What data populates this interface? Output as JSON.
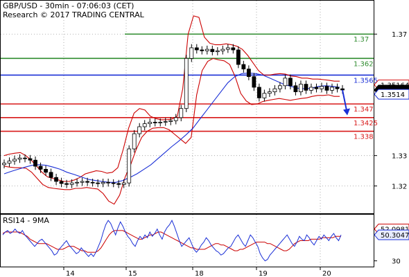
{
  "header": {
    "title": "GBP/USD - 30min - 07:06:03 (CET)",
    "subtitle": "Research © 2017 TRADING CENTRAL"
  },
  "rsi_label": "RSI14 - 9MA",
  "colors": {
    "resistance": "#2e8b2e",
    "pivot": "#1a2fd6",
    "support": "#d81818",
    "bollinger": "#cc0000",
    "ma": "#1a2fd6",
    "candle": "#000000",
    "rsi": "#1a2fd6",
    "rsi_ma": "#cc0000",
    "arrow": "#1a2fd6"
  },
  "chart_data": [
    {
      "type": "line",
      "title": "GBP/USD - 30min",
      "x_ticks": [
        "14",
        "15",
        "18",
        "19",
        "20"
      ],
      "ylim": [
        1.311,
        1.381
      ],
      "y_ticks": [
        1.32,
        1.33,
        1.37
      ],
      "grid": true,
      "levels": [
        {
          "label": "1.37",
          "value": 1.37,
          "kind": "resistance"
        },
        {
          "label": "1.362",
          "value": 1.362,
          "kind": "resistance"
        },
        {
          "label": "1.3565",
          "value": 1.3565,
          "kind": "pivot"
        },
        {
          "label": "1.347",
          "value": 1.347,
          "kind": "support"
        },
        {
          "label": "1.3425",
          "value": 1.3425,
          "kind": "support"
        },
        {
          "label": "1.338",
          "value": 1.338,
          "kind": "support"
        }
      ],
      "price_labels": [
        {
          "label": "1.35164",
          "value": 1.3533,
          "style": "support-box"
        },
        {
          "label": "1.3516",
          "value": 1.3516,
          "style": "black-box"
        },
        {
          "label": "1.3514",
          "value": 1.3502,
          "style": "blue-box"
        }
      ],
      "series": [
        {
          "type": "candles",
          "close": [
            1.3275,
            1.3282,
            1.3288,
            1.3292,
            1.329,
            1.3285,
            1.3265,
            1.3255,
            1.3245,
            1.3228,
            1.3215,
            1.3208,
            1.3205,
            1.321,
            1.3212,
            1.3215,
            1.3212,
            1.321,
            1.3208,
            1.3212,
            1.321,
            1.3208,
            1.3205,
            1.321,
            1.3322,
            1.3372,
            1.3395,
            1.3405,
            1.341,
            1.3408,
            1.341,
            1.3412,
            1.3415,
            1.3425,
            1.3455,
            1.362,
            1.3655,
            1.3648,
            1.3645,
            1.365,
            1.3642,
            1.3645,
            1.365,
            1.3655,
            1.3648,
            1.36,
            1.3585,
            1.356,
            1.3525,
            1.349,
            1.3505,
            1.351,
            1.352,
            1.353,
            1.3555,
            1.353,
            1.351,
            1.3535,
            1.3515,
            1.3525,
            1.352,
            1.3528,
            1.3515,
            1.3525,
            1.352,
            1.3516
          ]
        },
        {
          "type": "line",
          "role": "upper-band",
          "values": [
            1.33,
            1.3305,
            1.3308,
            1.331,
            1.33,
            1.3285,
            1.3265,
            1.3245,
            1.323,
            1.3225,
            1.322,
            1.3215,
            1.3215,
            1.322,
            1.3228,
            1.324,
            1.3245,
            1.325,
            1.3248,
            1.3242,
            1.3245,
            1.326,
            1.332,
            1.339,
            1.344,
            1.3455,
            1.345,
            1.343,
            1.3422,
            1.3418,
            1.3418,
            1.342,
            1.343,
            1.352,
            1.37,
            1.376,
            1.3755,
            1.369,
            1.367,
            1.3665,
            1.3665,
            1.3668,
            1.3665,
            1.366,
            1.365,
            1.363,
            1.3605,
            1.358,
            1.3565,
            1.3565,
            1.3568,
            1.357,
            1.3568,
            1.3562,
            1.356,
            1.3555,
            1.3555,
            1.3552,
            1.3552,
            1.355,
            1.3548,
            1.3545,
            1.3545
          ]
        },
        {
          "type": "line",
          "role": "lower-band",
          "values": [
            1.3265,
            1.3262,
            1.326,
            1.326,
            1.3258,
            1.3245,
            1.3225,
            1.3205,
            1.3195,
            1.3192,
            1.319,
            1.3188,
            1.3188,
            1.3192,
            1.3192,
            1.3195,
            1.3192,
            1.319,
            1.3175,
            1.315,
            1.314,
            1.317,
            1.323,
            1.327,
            1.332,
            1.336,
            1.338,
            1.339,
            1.3392,
            1.3392,
            1.3385,
            1.337,
            1.3355,
            1.334,
            1.336,
            1.35,
            1.358,
            1.361,
            1.362,
            1.3615,
            1.3612,
            1.36,
            1.356,
            1.3505,
            1.348,
            1.3468,
            1.347,
            1.3478,
            1.3482,
            1.3485,
            1.3488,
            1.3485,
            1.3482,
            1.3485,
            1.3488,
            1.349,
            1.3495,
            1.3498,
            1.3498,
            1.35,
            1.3495,
            1.3495
          ]
        },
        {
          "type": "line",
          "role": "moving-average",
          "values": [
            1.324,
            1.3248,
            1.3255,
            1.3262,
            1.3268,
            1.327,
            1.3268,
            1.3262,
            1.3255,
            1.3245,
            1.3238,
            1.323,
            1.3222,
            1.3218,
            1.3215,
            1.3212,
            1.3212,
            1.3218,
            1.3228,
            1.324,
            1.3255,
            1.327,
            1.329,
            1.331,
            1.333,
            1.3348,
            1.3368,
            1.339,
            1.342,
            1.345,
            1.348,
            1.351,
            1.354,
            1.356,
            1.357,
            1.3572,
            1.357,
            1.3565,
            1.3555,
            1.3545,
            1.3535,
            1.3528,
            1.3522,
            1.352,
            1.3522,
            1.3528,
            1.353,
            1.3528,
            1.3525
          ]
        }
      ]
    },
    {
      "type": "line",
      "title": "RSI14 - 9MA",
      "ylim": [
        26,
        62
      ],
      "y_ticks": [
        30
      ],
      "value_labels": [
        {
          "label": "52.0981",
          "value": 52.1,
          "style": "rsi-ma-box"
        },
        {
          "label": "50.3047",
          "value": 48.0,
          "style": "rsi-box"
        }
      ],
      "series": [
        {
          "name": "RSI14",
          "values": [
            48,
            50,
            51,
            49,
            50,
            52,
            50,
            49,
            51,
            48,
            46,
            44,
            42,
            40,
            42,
            44,
            45,
            43,
            41,
            39,
            37,
            34,
            35,
            38,
            40,
            42,
            44,
            41,
            39,
            37,
            35,
            36,
            39,
            37,
            35,
            33,
            35,
            33,
            36,
            40,
            44,
            50,
            55,
            58,
            56,
            52,
            48,
            53,
            57,
            54,
            50,
            47,
            45,
            42,
            40,
            44,
            47,
            45,
            48,
            46,
            50,
            47,
            49,
            52,
            48,
            45,
            50,
            53,
            55,
            58,
            54,
            49,
            44,
            40,
            42,
            44,
            46,
            42,
            38,
            36,
            38,
            41,
            43,
            46,
            44,
            41,
            39,
            37,
            36,
            34,
            35,
            37,
            39,
            40,
            43,
            46,
            48,
            45,
            42,
            40,
            44,
            48,
            46,
            43,
            40,
            35,
            32,
            30,
            31,
            34,
            36,
            38,
            40,
            42,
            44,
            46,
            48,
            45,
            42,
            40,
            43,
            47,
            45,
            44,
            48,
            46,
            43,
            41,
            44,
            47,
            45,
            48,
            46,
            44,
            47,
            49,
            46,
            44,
            48
          ]
        },
        {
          "name": "9MA",
          "values": [
            49,
            50,
            50,
            50,
            50,
            50,
            50,
            49,
            48,
            47,
            45,
            44,
            43,
            42,
            42,
            42,
            42,
            41,
            40,
            39,
            38,
            38,
            38,
            39,
            40,
            40,
            40,
            39,
            38,
            37,
            37,
            36,
            36,
            36,
            36,
            37,
            39,
            42,
            45,
            48,
            50,
            51,
            51,
            51,
            51,
            50,
            49,
            48,
            47,
            46,
            45,
            45,
            46,
            47,
            48,
            48,
            49,
            50,
            50,
            49,
            48,
            47,
            46,
            45,
            44,
            43,
            42,
            41,
            40,
            39,
            39,
            38,
            38,
            38,
            38,
            39,
            40,
            41,
            42,
            42,
            41,
            41,
            40,
            39,
            38,
            37,
            37,
            38,
            38,
            39,
            40,
            41,
            42,
            43,
            43,
            43,
            43,
            42,
            42,
            41,
            40,
            39,
            38,
            37,
            37,
            38,
            40,
            42,
            43,
            44,
            44,
            44,
            44,
            45,
            45,
            45,
            45,
            46,
            46,
            46,
            46,
            46,
            47,
            47,
            47
          ]
        }
      ]
    }
  ]
}
